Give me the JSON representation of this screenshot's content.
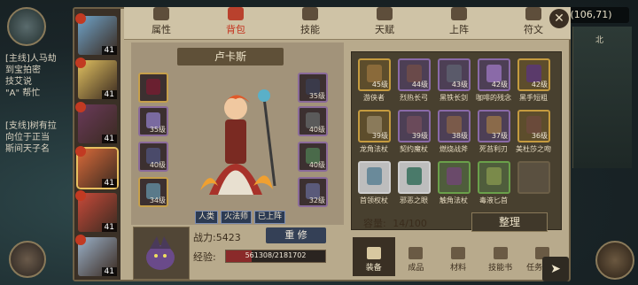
{
  "world": {
    "coords": "(106,71)",
    "north": "北",
    "chat_lines": [
      "[主线]人马劫",
      "到宝拍密",
      "技艾说",
      "\"A\" 帮忙",
      "[支线]树有拉",
      "向位于正当",
      "斯间天子名"
    ]
  },
  "tabs": [
    {
      "label": "属性",
      "icon": "attribute-icon",
      "active": false
    },
    {
      "label": "背包",
      "icon": "bag-icon",
      "active": true
    },
    {
      "label": "技能",
      "icon": "book-icon",
      "active": false
    },
    {
      "label": "天赋",
      "icon": "eye-icon",
      "active": false
    },
    {
      "label": "上阵",
      "icon": "swords-icon",
      "active": false
    },
    {
      "label": "符文",
      "icon": "rune-icon",
      "active": false
    }
  ],
  "heroes": [
    {
      "level": "41",
      "selected": false,
      "color": "#6fa3c9"
    },
    {
      "level": "41",
      "selected": false,
      "color": "#e0c060"
    },
    {
      "level": "41",
      "selected": false,
      "color": "#6a3a5a"
    },
    {
      "level": "41",
      "selected": true,
      "color": "#d86a3a"
    },
    {
      "level": "41",
      "selected": false,
      "color": "#c84a3a"
    },
    {
      "level": "41",
      "selected": false,
      "color": "#9ab0c8"
    }
  ],
  "character": {
    "name": "卢卡斯",
    "tags": [
      "人类",
      "火法师",
      "已上阵"
    ],
    "power_label": "战力:5423",
    "rebuild_label": "重 修",
    "exp_label": "经验:",
    "exp_text": "561308/2181702",
    "exp_fraction": 0.257
  },
  "equip_slots": {
    "left": [
      {
        "level": "",
        "border": "gold",
        "color": "#6a2030"
      },
      {
        "level": "35级",
        "border": "purple",
        "color": "#7a6aa0"
      },
      {
        "level": "40级",
        "border": "purple",
        "color": "#4a4a6a"
      },
      {
        "level": "34级",
        "border": "gold",
        "color": "#5a7a8a"
      }
    ],
    "right": [
      {
        "level": "35级",
        "border": "purple",
        "color": "#3a3a4a"
      },
      {
        "level": "40级",
        "border": "purple",
        "color": "#5a5a5a"
      },
      {
        "level": "40级",
        "border": "purple",
        "color": "#4a6a4a"
      },
      {
        "level": "32级",
        "border": "purple",
        "color": "#5a5a7a"
      }
    ]
  },
  "inventory": {
    "items": [
      {
        "name": "游侠者",
        "level": "45级",
        "border": "gold",
        "color": "#8a6a3a"
      },
      {
        "name": "烈热长弓",
        "level": "44级",
        "border": "purple",
        "color": "#6a4a4a"
      },
      {
        "name": "黑铁长剑",
        "level": "43级",
        "border": "purple",
        "color": "#5a5a6a"
      },
      {
        "name": "咖啡的残念",
        "level": "42级",
        "border": "purple",
        "color": "#8a6aa8"
      },
      {
        "name": "黑手短粗",
        "level": "42级",
        "border": "gold",
        "color": "#5a3a6a"
      },
      {
        "name": "龙角法杖",
        "level": "39级",
        "border": "gold",
        "color": "#8a7a5a"
      },
      {
        "name": "契约魔杖",
        "level": "39级",
        "border": "purple",
        "color": "#6a4a5a"
      },
      {
        "name": "燃烧战斧",
        "level": "38级",
        "border": "purple",
        "color": "#7a5a4a"
      },
      {
        "name": "死苔利刃",
        "level": "37级",
        "border": "purple",
        "color": "#8a6a4a"
      },
      {
        "name": "美杜莎之吻",
        "level": "36级",
        "border": "gold",
        "color": "#6a4a3a"
      },
      {
        "name": "首领权杖",
        "level": "",
        "border": "white",
        "color": "#6a8a9a"
      },
      {
        "name": "邪恶之眼",
        "level": "",
        "border": "white",
        "color": "#4a7a6a"
      },
      {
        "name": "触角法杖",
        "level": "",
        "border": "green",
        "color": "#6a4a6a"
      },
      {
        "name": "毒液匕首",
        "level": "",
        "border": "green",
        "color": "#7a8a4a"
      },
      {
        "name": "",
        "level": "",
        "border": "empty",
        "color": ""
      }
    ],
    "capacity_label": "容量:",
    "capacity_value": "14/100",
    "sort_label": "整理"
  },
  "bottom_tabs": [
    {
      "label": "装备",
      "icon": "hammer-icon",
      "active": true
    },
    {
      "label": "成品",
      "icon": "bottle-icon",
      "active": false
    },
    {
      "label": "材料",
      "icon": "material-icon",
      "active": false
    },
    {
      "label": "技能书",
      "icon": "skillbook-icon",
      "active": false
    },
    {
      "label": "任务物品",
      "icon": "quest-icon",
      "active": false
    }
  ]
}
